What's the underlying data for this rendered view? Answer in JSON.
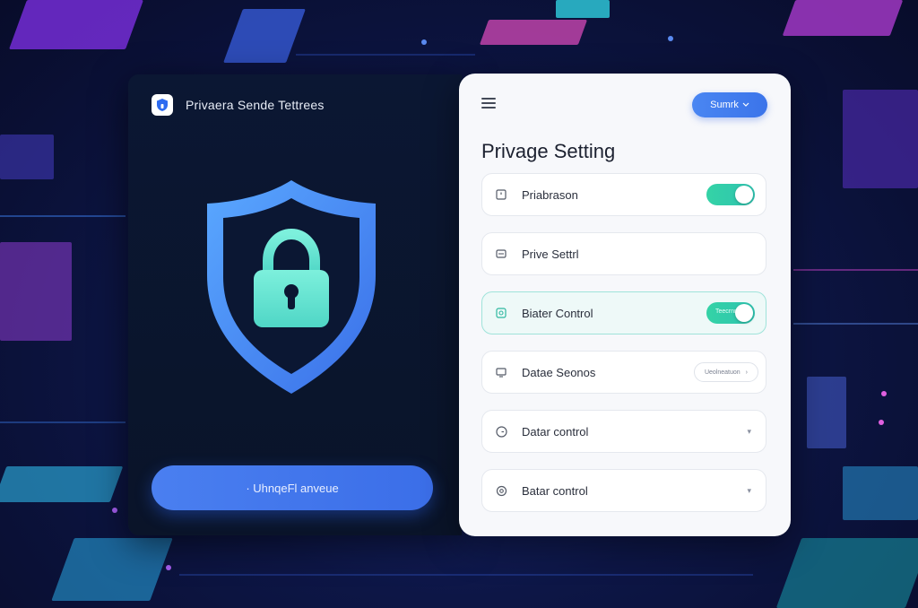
{
  "app": {
    "title": "Privaera Sende Tettrees"
  },
  "left_panel": {
    "action_button_label": "· UhnqeFl anveue"
  },
  "right_panel": {
    "search_label": "Sumrk",
    "page_title": "Privage Setting",
    "rows": [
      {
        "label": "Priabrason",
        "icon": "window-icon",
        "control": "toggle",
        "state": "on",
        "control_text": ""
      },
      {
        "label": "Prive Settrl",
        "icon": "card-icon",
        "control": "none",
        "state": "",
        "control_text": ""
      },
      {
        "label": "Biater Control",
        "icon": "shield-check-icon",
        "control": "toggle",
        "state": "on",
        "control_text": "Teecrnml"
      },
      {
        "label": "Datae Seonos",
        "icon": "monitor-icon",
        "control": "select",
        "state": "",
        "control_text": "Ueolneatuon"
      },
      {
        "label": "Datar control",
        "icon": "clock-icon",
        "control": "chevron",
        "state": "",
        "control_text": ""
      },
      {
        "label": "Batar control",
        "icon": "gear-icon",
        "control": "chevron",
        "state": "",
        "control_text": ""
      }
    ]
  },
  "colors": {
    "accent_blue": "#3b74ea",
    "toggle_green": "#34d3a6",
    "shield_blue": "#4a8cf5",
    "lock_mint": "#5ee6cf"
  }
}
